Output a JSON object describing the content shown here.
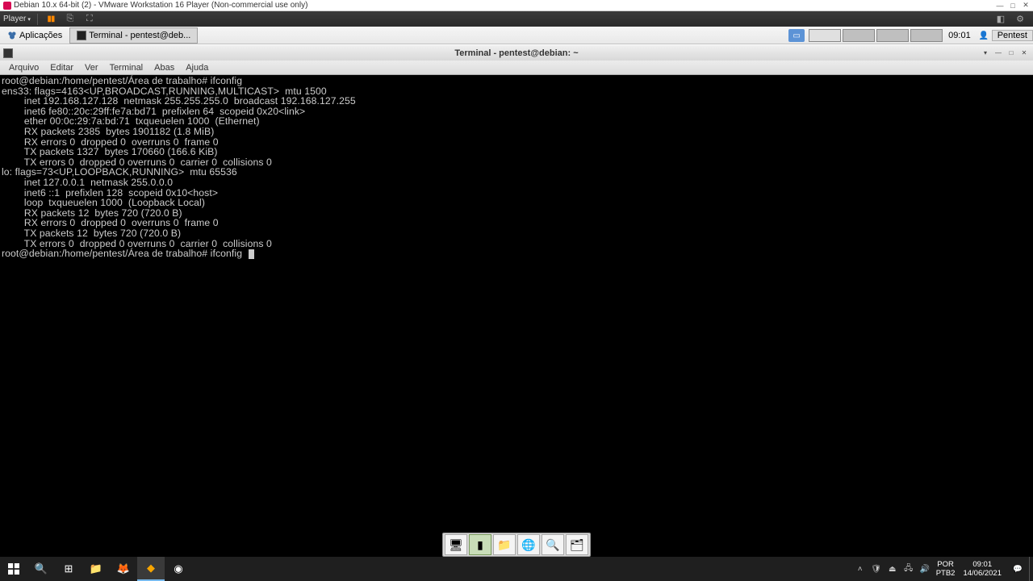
{
  "vmware": {
    "title": "Debian 10.x 64-bit (2) - VMware Workstation 16 Player (Non-commercial use only)",
    "player_label": "Player"
  },
  "guest_taskbar": {
    "apps_label": "Aplicações",
    "term_tab_label": "Terminal - pentest@deb...",
    "clock": "09:01",
    "user": "Pentest"
  },
  "term_window": {
    "title": "Terminal - pentest@debian: ~",
    "menu": [
      "Arquivo",
      "Editar",
      "Ver",
      "Terminal",
      "Abas",
      "Ajuda"
    ]
  },
  "terminal": {
    "lines": [
      "root@debian:/home/pentest/Área de trabalho# ifconfig",
      "ens33: flags=4163<UP,BROADCAST,RUNNING,MULTICAST>  mtu 1500",
      "        inet 192.168.127.128  netmask 255.255.255.0  broadcast 192.168.127.255",
      "        inet6 fe80::20c:29ff:fe7a:bd71  prefixlen 64  scopeid 0x20<link>",
      "        ether 00:0c:29:7a:bd:71  txqueuelen 1000  (Ethernet)",
      "        RX packets 2385  bytes 1901182 (1.8 MiB)",
      "        RX errors 0  dropped 0  overruns 0  frame 0",
      "        TX packets 1327  bytes 170660 (166.6 KiB)",
      "        TX errors 0  dropped 0 overruns 0  carrier 0  collisions 0",
      "",
      "lo: flags=73<UP,LOOPBACK,RUNNING>  mtu 65536",
      "        inet 127.0.0.1  netmask 255.0.0.0",
      "        inet6 ::1  prefixlen 128  scopeid 0x10<host>",
      "        loop  txqueuelen 1000  (Loopback Local)",
      "        RX packets 12  bytes 720 (720.0 B)",
      "        RX errors 0  dropped 0  overruns 0  frame 0",
      "        TX packets 12  bytes 720 (720.0 B)",
      "        TX errors 0  dropped 0 overruns 0  carrier 0  collisions 0",
      "",
      "root@debian:/home/pentest/Área de trabalho# ifconfig "
    ]
  },
  "windows_taskbar": {
    "lang1": "POR",
    "lang2": "PTB2",
    "time": "09:01",
    "date": "14/06/2021"
  }
}
